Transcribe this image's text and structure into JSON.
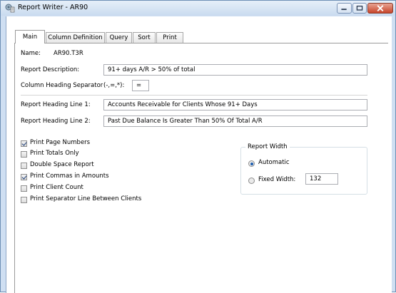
{
  "window": {
    "title": "Report Writer - AR90",
    "minimize_icon": "minimize-icon",
    "maximize_icon": "maximize-icon",
    "close_icon": "close-icon"
  },
  "tabs": [
    {
      "label": "Main",
      "active": true
    },
    {
      "label": "Column Definition",
      "active": false
    },
    {
      "label": "Query",
      "active": false
    },
    {
      "label": "Sort",
      "active": false
    },
    {
      "label": "Print",
      "active": false
    }
  ],
  "main": {
    "name_label": "Name:",
    "name_value": "AR90.T3R",
    "description_label": "Report Description:",
    "description_value": "91+ days A/R > 50% of total",
    "separator_label": "Column Heading Separator",
    "separator_hint": "(-,=,*):",
    "separator_value": "=",
    "heading1_label": "Report Heading Line 1:",
    "heading1_value": "Accounts Receivable for Clients Whose 91+ Days",
    "heading2_label": "Report Heading Line 2:",
    "heading2_value": "Past Due Balance Is Greater Than 50% Of Total A/R"
  },
  "options": [
    {
      "label": "Print Page Numbers",
      "checked": true
    },
    {
      "label": "Print Totals Only",
      "checked": false
    },
    {
      "label": "Double Space Report",
      "checked": false
    },
    {
      "label": "Print Commas in Amounts",
      "checked": true
    },
    {
      "label": "Print Client Count",
      "checked": false
    },
    {
      "label": "Print Separator Line Between Clients",
      "checked": false
    }
  ],
  "report_width": {
    "title": "Report Width",
    "automatic_label": "Automatic",
    "fixed_label": "Fixed Width:",
    "fixed_value": "132",
    "selected": "automatic"
  }
}
